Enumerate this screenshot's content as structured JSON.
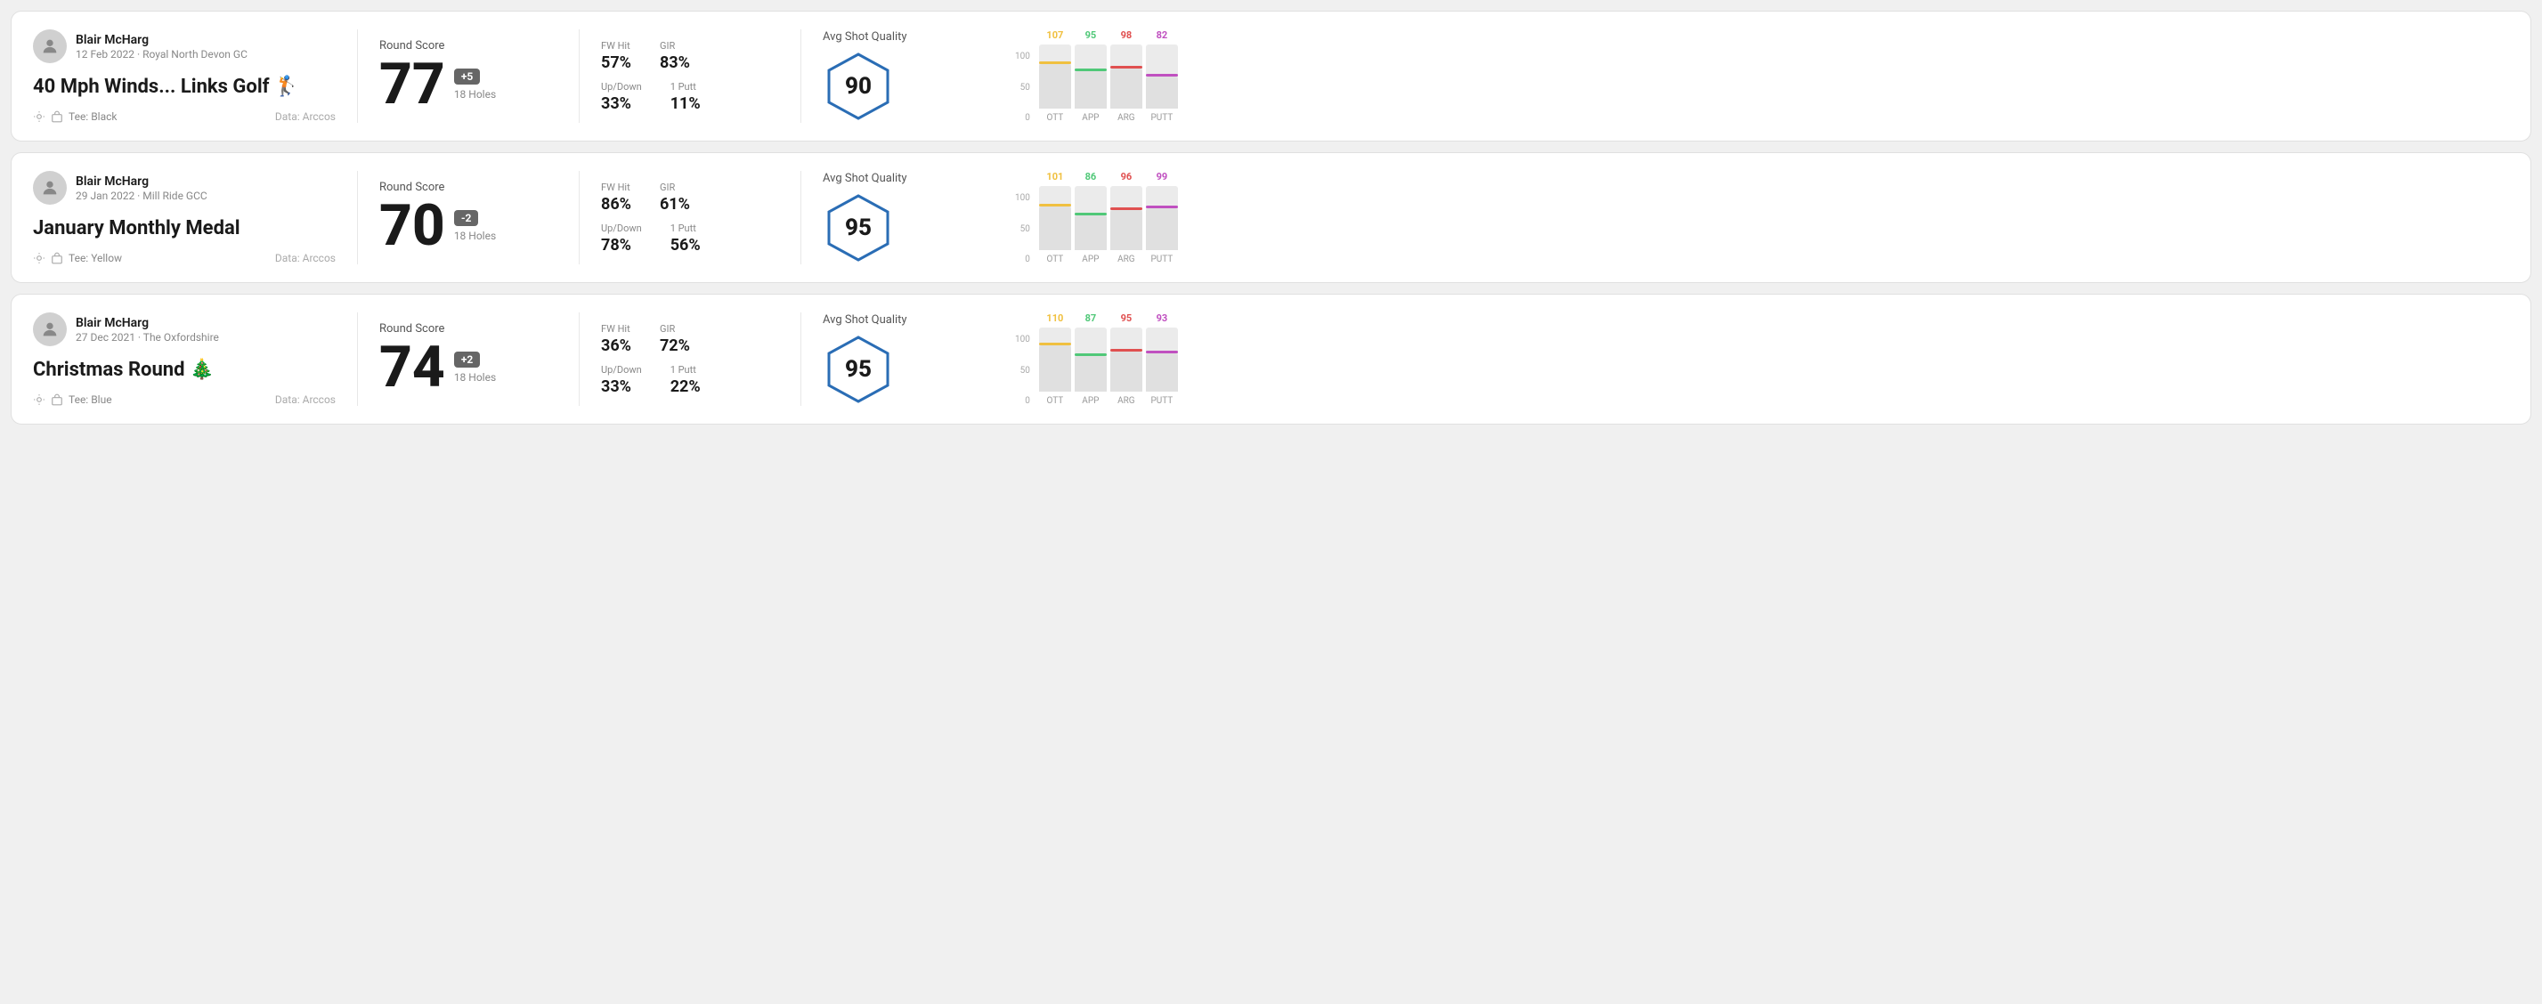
{
  "cards": [
    {
      "id": "card1",
      "user": {
        "name": "Blair McHarg",
        "date": "12 Feb 2022 · Royal North Devon GC"
      },
      "title": "40 Mph Winds... Links Golf 🏌️",
      "tee": "Tee: Black",
      "data_source": "Data: Arccos",
      "score": {
        "label": "Round Score",
        "number": "77",
        "badge": "+5",
        "badge_type": "gray",
        "holes": "18 Holes"
      },
      "stats": {
        "fw_hit_label": "FW Hit",
        "fw_hit_value": "57%",
        "gir_label": "GIR",
        "gir_value": "83%",
        "updown_label": "Up/Down",
        "updown_value": "33%",
        "oneputt_label": "1 Putt",
        "oneputt_value": "11%"
      },
      "quality": {
        "label": "Avg Shot Quality",
        "score": "90"
      },
      "chart": {
        "bars": [
          {
            "label": "OTT",
            "value": 107,
            "color": "#f0c040",
            "bar_pct": 70
          },
          {
            "label": "APP",
            "value": 95,
            "color": "#50c878",
            "bar_pct": 58
          },
          {
            "label": "ARG",
            "value": 98,
            "color": "#e05050",
            "bar_pct": 62
          },
          {
            "label": "PUTT",
            "value": 82,
            "color": "#c050c0",
            "bar_pct": 50
          }
        ],
        "y_labels": [
          "100",
          "50",
          "0"
        ]
      }
    },
    {
      "id": "card2",
      "user": {
        "name": "Blair McHarg",
        "date": "29 Jan 2022 · Mill Ride GCC"
      },
      "title": "January Monthly Medal",
      "tee": "Tee: Yellow",
      "data_source": "Data: Arccos",
      "score": {
        "label": "Round Score",
        "number": "70",
        "badge": "-2",
        "badge_type": "gray",
        "holes": "18 Holes"
      },
      "stats": {
        "fw_hit_label": "FW Hit",
        "fw_hit_value": "86%",
        "gir_label": "GIR",
        "gir_value": "61%",
        "updown_label": "Up/Down",
        "updown_value": "78%",
        "oneputt_label": "1 Putt",
        "oneputt_value": "56%"
      },
      "quality": {
        "label": "Avg Shot Quality",
        "score": "95"
      },
      "chart": {
        "bars": [
          {
            "label": "OTT",
            "value": 101,
            "color": "#f0c040",
            "bar_pct": 68
          },
          {
            "label": "APP",
            "value": 86,
            "color": "#50c878",
            "bar_pct": 54
          },
          {
            "label": "ARG",
            "value": 96,
            "color": "#e05050",
            "bar_pct": 62
          },
          {
            "label": "PUTT",
            "value": 99,
            "color": "#c050c0",
            "bar_pct": 65
          }
        ],
        "y_labels": [
          "100",
          "50",
          "0"
        ]
      }
    },
    {
      "id": "card3",
      "user": {
        "name": "Blair McHarg",
        "date": "27 Dec 2021 · The Oxfordshire"
      },
      "title": "Christmas Round 🎄",
      "tee": "Tee: Blue",
      "data_source": "Data: Arccos",
      "score": {
        "label": "Round Score",
        "number": "74",
        "badge": "+2",
        "badge_type": "gray",
        "holes": "18 Holes"
      },
      "stats": {
        "fw_hit_label": "FW Hit",
        "fw_hit_value": "36%",
        "gir_label": "GIR",
        "gir_value": "72%",
        "updown_label": "Up/Down",
        "updown_value": "33%",
        "oneputt_label": "1 Putt",
        "oneputt_value": "22%"
      },
      "quality": {
        "label": "Avg Shot Quality",
        "score": "95"
      },
      "chart": {
        "bars": [
          {
            "label": "OTT",
            "value": 110,
            "color": "#f0c040",
            "bar_pct": 72
          },
          {
            "label": "APP",
            "value": 87,
            "color": "#50c878",
            "bar_pct": 55
          },
          {
            "label": "ARG",
            "value": 95,
            "color": "#e05050",
            "bar_pct": 62
          },
          {
            "label": "PUTT",
            "value": 93,
            "color": "#c050c0",
            "bar_pct": 60
          }
        ],
        "y_labels": [
          "100",
          "50",
          "0"
        ]
      }
    }
  ]
}
